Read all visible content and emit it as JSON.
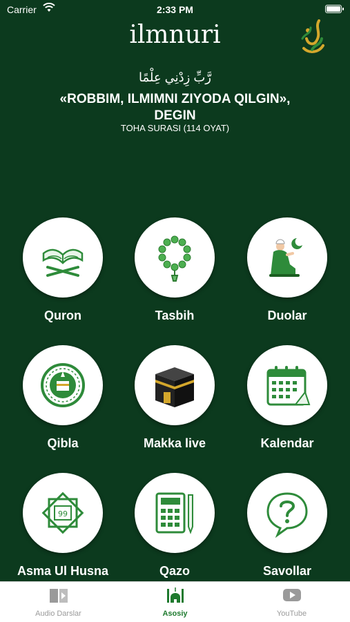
{
  "status_bar": {
    "carrier": "Carrier",
    "time": "2:33 PM"
  },
  "header": {
    "title": "ilmnuri"
  },
  "verse": {
    "arabic": "رَّبِّ زِدْنِي عِلْمًا",
    "uzbek_line1": "«ROBBIM, ILMIMNI ZIYODA QILGIN»,",
    "uzbek_line2": "DEGIN",
    "source": "TOHA SURASI (114 OYAT)"
  },
  "menu": [
    {
      "label": "Quron",
      "icon": "quran-icon"
    },
    {
      "label": "Tasbih",
      "icon": "tasbih-icon"
    },
    {
      "label": "Duolar",
      "icon": "prayer-icon"
    },
    {
      "label": "Qibla",
      "icon": "qibla-compass-icon"
    },
    {
      "label": "Makka live",
      "icon": "kaaba-icon"
    },
    {
      "label": "Kalendar",
      "icon": "calendar-icon"
    },
    {
      "label": "Asma Ul Husna",
      "icon": "asma-ul-husna-icon",
      "badge": "99"
    },
    {
      "label": "Qazo",
      "icon": "calculator-icon"
    },
    {
      "label": "Savollar",
      "icon": "question-bubble-icon"
    }
  ],
  "tabs": [
    {
      "label": "Audio Darslar",
      "icon": "audio-book-icon",
      "active": false
    },
    {
      "label": "Asosiy",
      "icon": "mosque-icon",
      "active": true
    },
    {
      "label": "YouTube",
      "icon": "youtube-icon",
      "active": false
    }
  ],
  "colors": {
    "background": "#0c3a1e",
    "accent": "#1e7a2e",
    "icon_green": "#2e8b3a",
    "tab_inactive": "#9a9a9a"
  }
}
